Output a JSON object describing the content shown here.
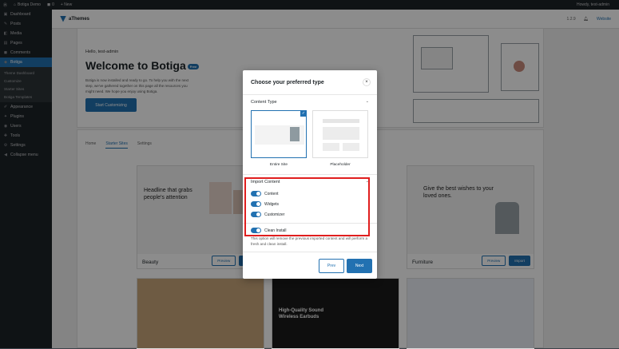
{
  "adminbar": {
    "site": "Botiga Demo",
    "comments": "0",
    "new": "+ New",
    "user": "Howdy, test-admin"
  },
  "sidebar": {
    "items": [
      {
        "label": "Dashboard",
        "icon": "dashboard-icon",
        "glyph": "▣"
      },
      {
        "label": "Posts",
        "icon": "pin-icon",
        "glyph": "✎"
      },
      {
        "label": "Media",
        "icon": "media-icon",
        "glyph": "◧"
      },
      {
        "label": "Pages",
        "icon": "page-icon",
        "glyph": "▤"
      },
      {
        "label": "Comments",
        "icon": "comment-icon",
        "glyph": "◼"
      },
      {
        "label": "Botiga",
        "icon": "botiga-icon",
        "glyph": "◆"
      }
    ],
    "submenu": [
      "Theme Dashboard",
      "Customize",
      "Starter Sites",
      "Botiga Templates"
    ],
    "items2": [
      {
        "label": "Appearance",
        "icon": "brush-icon",
        "glyph": "✐"
      },
      {
        "label": "Plugins",
        "icon": "plugin-icon",
        "glyph": "✦"
      },
      {
        "label": "Users",
        "icon": "users-icon",
        "glyph": "◉"
      },
      {
        "label": "Tools",
        "icon": "tools-icon",
        "glyph": "✚"
      },
      {
        "label": "Settings",
        "icon": "settings-icon",
        "glyph": "⚙"
      },
      {
        "label": "Collapse menu",
        "icon": "collapse-icon",
        "glyph": "◀"
      }
    ]
  },
  "topbar": {
    "brand": "aThemes",
    "version": "1.2.9",
    "website": "Website"
  },
  "welcome": {
    "hello": "Hello, test-admin",
    "title": "Welcome to Botiga",
    "badge": "Free",
    "desc": "Botiga is now installed and ready to go. To help you with the next step, we've gathered together on this page all the resources you might need. We hope you enjoy using Botiga.",
    "start": "Start Customizing"
  },
  "starter": {
    "tabs": [
      "Home",
      "Starter Sites",
      "Settings"
    ],
    "cards": [
      {
        "name": "Beauty",
        "headline": "Headline that grabs people's attention",
        "preview": "Preview",
        "import": "Import"
      },
      {
        "name": "Furniture",
        "headline": "Give the best wishes to your loved ones.",
        "preview": "Preview",
        "import": "Import"
      }
    ],
    "row2": [
      {
        "headline": "",
        "dark": false
      },
      {
        "headline": "High-Quality Sound Wireless Earbuds",
        "dark": true
      },
      {
        "headline": "",
        "dark": false
      }
    ]
  },
  "modal": {
    "title": "Choose your preferred type",
    "close": "×",
    "content_type": "Content Type",
    "types": [
      {
        "label": "Entire Site",
        "selected": true
      },
      {
        "label": "Placeholder",
        "selected": false
      }
    ],
    "import_content": "Import Content",
    "toggles": [
      "Content",
      "Widgets",
      "Customizer"
    ],
    "clean": "Clean Install",
    "clean_note": "This option will remove the previous imported content and will perform a fresh and clean install.",
    "prev": "Prev",
    "next": "Next"
  },
  "colors": {
    "accent": "#2271b1",
    "highlight": "#e01e1e"
  }
}
